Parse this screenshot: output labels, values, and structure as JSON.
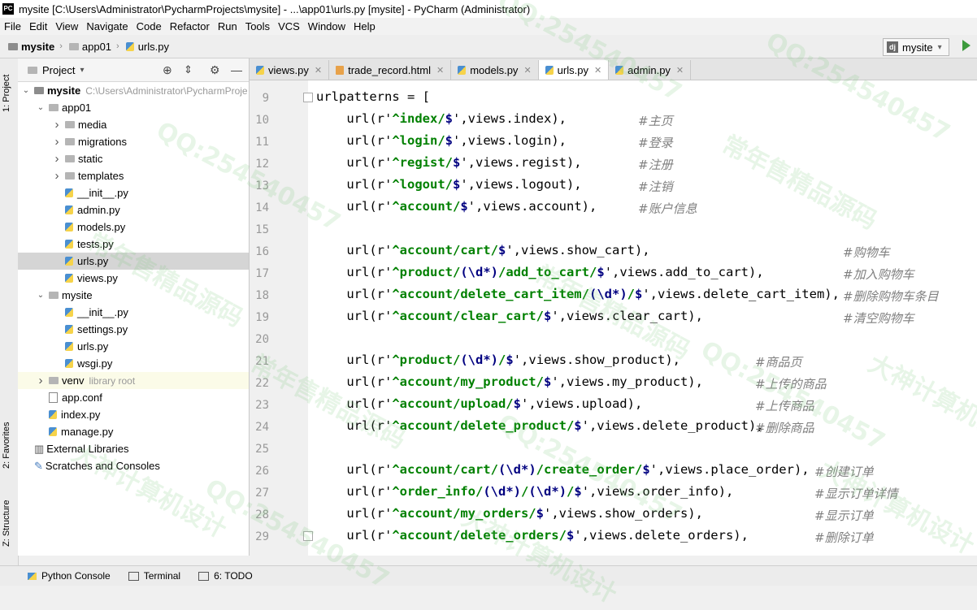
{
  "window": {
    "title": "mysite [C:\\Users\\Administrator\\PycharmProjects\\mysite] - ...\\app01\\urls.py [mysite] - PyCharm (Administrator)",
    "logo": "PC"
  },
  "menu": [
    "File",
    "Edit",
    "View",
    "Navigate",
    "Code",
    "Refactor",
    "Run",
    "Tools",
    "VCS",
    "Window",
    "Help"
  ],
  "breadcrumb": [
    "mysite",
    "app01",
    "urls.py"
  ],
  "run_config": {
    "label": "mysite",
    "icon": "dj"
  },
  "left_tools": {
    "project": "1: Project",
    "favorites": "2: Favorites",
    "structure": "Z: Structure"
  },
  "project_panel": {
    "title": "Project",
    "tree": [
      {
        "label": "mysite",
        "hint": "C:\\Users\\Administrator\\PycharmProje",
        "indent": 0,
        "arrow": "down",
        "icon": "folder-dark",
        "bold": true
      },
      {
        "label": "app01",
        "indent": 1,
        "arrow": "down",
        "icon": "folder"
      },
      {
        "label": "media",
        "indent": 2,
        "arrow": "right",
        "icon": "folder"
      },
      {
        "label": "migrations",
        "indent": 2,
        "arrow": "right",
        "icon": "folder"
      },
      {
        "label": "static",
        "indent": 2,
        "arrow": "right",
        "icon": "folder"
      },
      {
        "label": "templates",
        "indent": 2,
        "arrow": "right",
        "icon": "folder"
      },
      {
        "label": "__init__.py",
        "indent": 2,
        "icon": "py"
      },
      {
        "label": "admin.py",
        "indent": 2,
        "icon": "py"
      },
      {
        "label": "models.py",
        "indent": 2,
        "icon": "py"
      },
      {
        "label": "tests.py",
        "indent": 2,
        "icon": "py"
      },
      {
        "label": "urls.py",
        "indent": 2,
        "icon": "py",
        "selected": true
      },
      {
        "label": "views.py",
        "indent": 2,
        "icon": "py"
      },
      {
        "label": "mysite",
        "indent": 1,
        "arrow": "down",
        "icon": "folder"
      },
      {
        "label": "__init__.py",
        "indent": 2,
        "icon": "py"
      },
      {
        "label": "settings.py",
        "indent": 2,
        "icon": "py"
      },
      {
        "label": "urls.py",
        "indent": 2,
        "icon": "py"
      },
      {
        "label": "wsgi.py",
        "indent": 2,
        "icon": "py"
      },
      {
        "label": "venv",
        "hint": "library root",
        "indent": 1,
        "arrow": "right",
        "icon": "folder",
        "highlight": true
      },
      {
        "label": "app.conf",
        "indent": 1,
        "icon": "file"
      },
      {
        "label": "index.py",
        "indent": 1,
        "icon": "py"
      },
      {
        "label": "manage.py",
        "indent": 1,
        "icon": "py"
      },
      {
        "label": "External Libraries",
        "indent": 0,
        "icon": "lib"
      },
      {
        "label": "Scratches and Consoles",
        "indent": 0,
        "icon": "scratch"
      }
    ]
  },
  "tabs": [
    {
      "label": "views.py",
      "icon": "py"
    },
    {
      "label": "trade_record.html",
      "icon": "html"
    },
    {
      "label": "models.py",
      "icon": "py"
    },
    {
      "label": "urls.py",
      "icon": "py",
      "active": true
    },
    {
      "label": "admin.py",
      "icon": "py"
    }
  ],
  "code_lines": [
    {
      "n": "9",
      "code": "urlpatterns = [",
      "comment": ""
    },
    {
      "n": "10",
      "code": "    url(r'^index/$',views.index),",
      "comment": "#主页",
      "col": 478
    },
    {
      "n": "11",
      "code": "    url(r'^login/$',views.login),",
      "comment": "#登录",
      "col": 478
    },
    {
      "n": "12",
      "code": "    url(r'^regist/$',views.regist),",
      "comment": "#注册",
      "col": 478
    },
    {
      "n": "13",
      "code": "    url(r'^logout/$',views.logout),",
      "comment": "#注销",
      "col": 478
    },
    {
      "n": "14",
      "code": "    url(r'^account/$',views.account),",
      "comment": "#账户信息",
      "col": 478
    },
    {
      "n": "15",
      "code": "",
      "comment": ""
    },
    {
      "n": "16",
      "code": "    url(r'^account/cart/$',views.show_cart),",
      "comment": "#购物车",
      "col": 730
    },
    {
      "n": "17",
      "code": "    url(r'^product/(\\d*)/add_to_cart/$',views.add_to_cart),",
      "comment": "#加入购物车",
      "col": 730
    },
    {
      "n": "18",
      "code": "    url(r'^account/delete_cart_item/(\\d*)/$',views.delete_cart_item),",
      "comment": "#删除购物车条目",
      "col": 730
    },
    {
      "n": "19",
      "code": "    url(r'^account/clear_cart/$',views.clear_cart),",
      "comment": "#清空购物车",
      "col": 730
    },
    {
      "n": "20",
      "code": "",
      "comment": ""
    },
    {
      "n": "21",
      "code": "    url(r'^product/(\\d*)/$',views.show_product),",
      "comment": "#商品页",
      "col": 622
    },
    {
      "n": "22",
      "code": "    url(r'^account/my_product/$',views.my_product),",
      "comment": "#上传的商品",
      "col": 622
    },
    {
      "n": "23",
      "code": "    url(r'^account/upload/$',views.upload),",
      "comment": "#上传商品",
      "col": 622
    },
    {
      "n": "24",
      "code": "    url(r'^account/delete_product/$',views.delete_product),",
      "comment": "#删除商品",
      "col": 622
    },
    {
      "n": "25",
      "code": "",
      "comment": ""
    },
    {
      "n": "26",
      "code": "    url(r'^account/cart/(\\d*)/create_order/$',views.place_order),",
      "comment": "#创建订单",
      "col": 695
    },
    {
      "n": "27",
      "code": "    url(r'^order_info/(\\d*)/(\\d*)/$',views.order_info),",
      "comment": "#显示订单详情",
      "col": 695
    },
    {
      "n": "28",
      "code": "    url(r'^account/my_orders/$',views.show_orders),",
      "comment": "#显示订单",
      "col": 695
    },
    {
      "n": "29",
      "code": "    url(r'^account/delete_orders/$',views.delete_orders),",
      "comment": "#删除订单",
      "col": 695
    }
  ],
  "bottom_tools": [
    {
      "label": "Python Console",
      "icon": "python-icon"
    },
    {
      "label": "Terminal",
      "icon": "terminal-icon"
    },
    {
      "label": "6: TODO",
      "icon": "todo-icon"
    }
  ],
  "watermark": [
    "QQ:254540457",
    "常年售精品源码",
    "大神计算机设计"
  ]
}
